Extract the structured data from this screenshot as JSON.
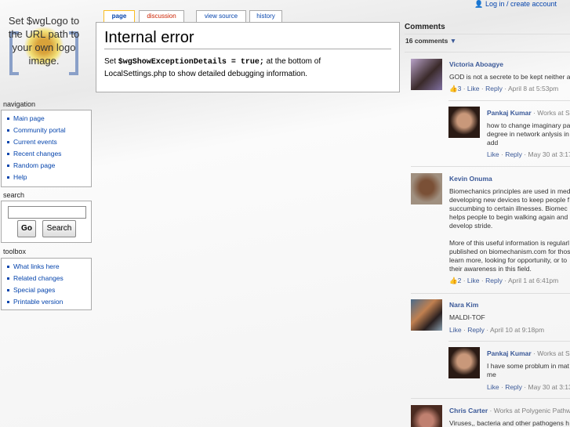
{
  "logo_text": "Set $wgLogo to the URL path to your own logo image.",
  "user_link": "Log in / create account",
  "tabs": [
    {
      "label": "page"
    },
    {
      "label": "discussion"
    },
    {
      "label": "view source"
    },
    {
      "label": "history"
    }
  ],
  "content": {
    "title": "Internal error",
    "pre": "Set ",
    "code": "$wgShowExceptionDetails = true;",
    "post": " at the bottom of",
    "line2": "LocalSettings.php to show detailed debugging information."
  },
  "navigation": {
    "title": "navigation",
    "items": [
      "Main page",
      "Community portal",
      "Current events",
      "Recent changes",
      "Random page",
      "Help"
    ]
  },
  "search": {
    "title": "search",
    "go": "Go",
    "search": "Search",
    "value": ""
  },
  "toolbox": {
    "title": "toolbox",
    "items": [
      "What links here",
      "Related changes",
      "Special pages",
      "Printable version"
    ]
  },
  "comments": {
    "title": "Comments",
    "count": "16 comments",
    "items": [
      {
        "name": "Victoria Aboagye",
        "work": "",
        "text": [
          "GOD is not a secrete to be kept neither a"
        ],
        "likes": "3",
        "like": "Like",
        "reply": "Reply",
        "date": "April 8 at 5:53pm"
      },
      {
        "name": "Pankaj Kumar",
        "work": "· Works at S",
        "text": [
          "how to change imaginary pa",
          "degree in network anlysis in",
          "add"
        ],
        "likes": "",
        "like": "Like",
        "reply": "Reply",
        "date": "May 30 at 3:17"
      },
      {
        "name": "Kevin Onuma",
        "work": "",
        "text": [
          "Biomechanics principles are used in med",
          "developing new devices to keep people f",
          "succumbing to certain illnesses. Biomec",
          "helps people to begin walking again and a",
          "develop stride.",
          "",
          "More of this useful information is regularl",
          "published on biomechanism.com for thos",
          "learn more, looking for opportunity, or to",
          "their awareness in this field."
        ],
        "likes": "2",
        "like": "Like",
        "reply": "Reply",
        "date": "April 1 at 6:41pm"
      },
      {
        "name": "Nara Kim",
        "work": "",
        "text": [
          "MALDI-TOF"
        ],
        "likes": "",
        "like": "Like",
        "reply": "Reply",
        "date": "April 10 at 9:18pm"
      },
      {
        "name": "Pankaj Kumar",
        "work": "· Works at S",
        "text": [
          "I have some problum in mat",
          "me"
        ],
        "likes": "",
        "like": "Like",
        "reply": "Reply",
        "date": "May 30 at 3:13"
      },
      {
        "name": "Chris Carter",
        "work": "· Works at Polygenic Pathw",
        "text": [
          "Viruses,, bacteria and other pathogens h"
        ],
        "likes": "",
        "like": "",
        "reply": "",
        "date": ""
      }
    ]
  },
  "colors": {
    "link": "#0645ad",
    "fb": "#3b5998",
    "discussion": "#cc2200"
  }
}
